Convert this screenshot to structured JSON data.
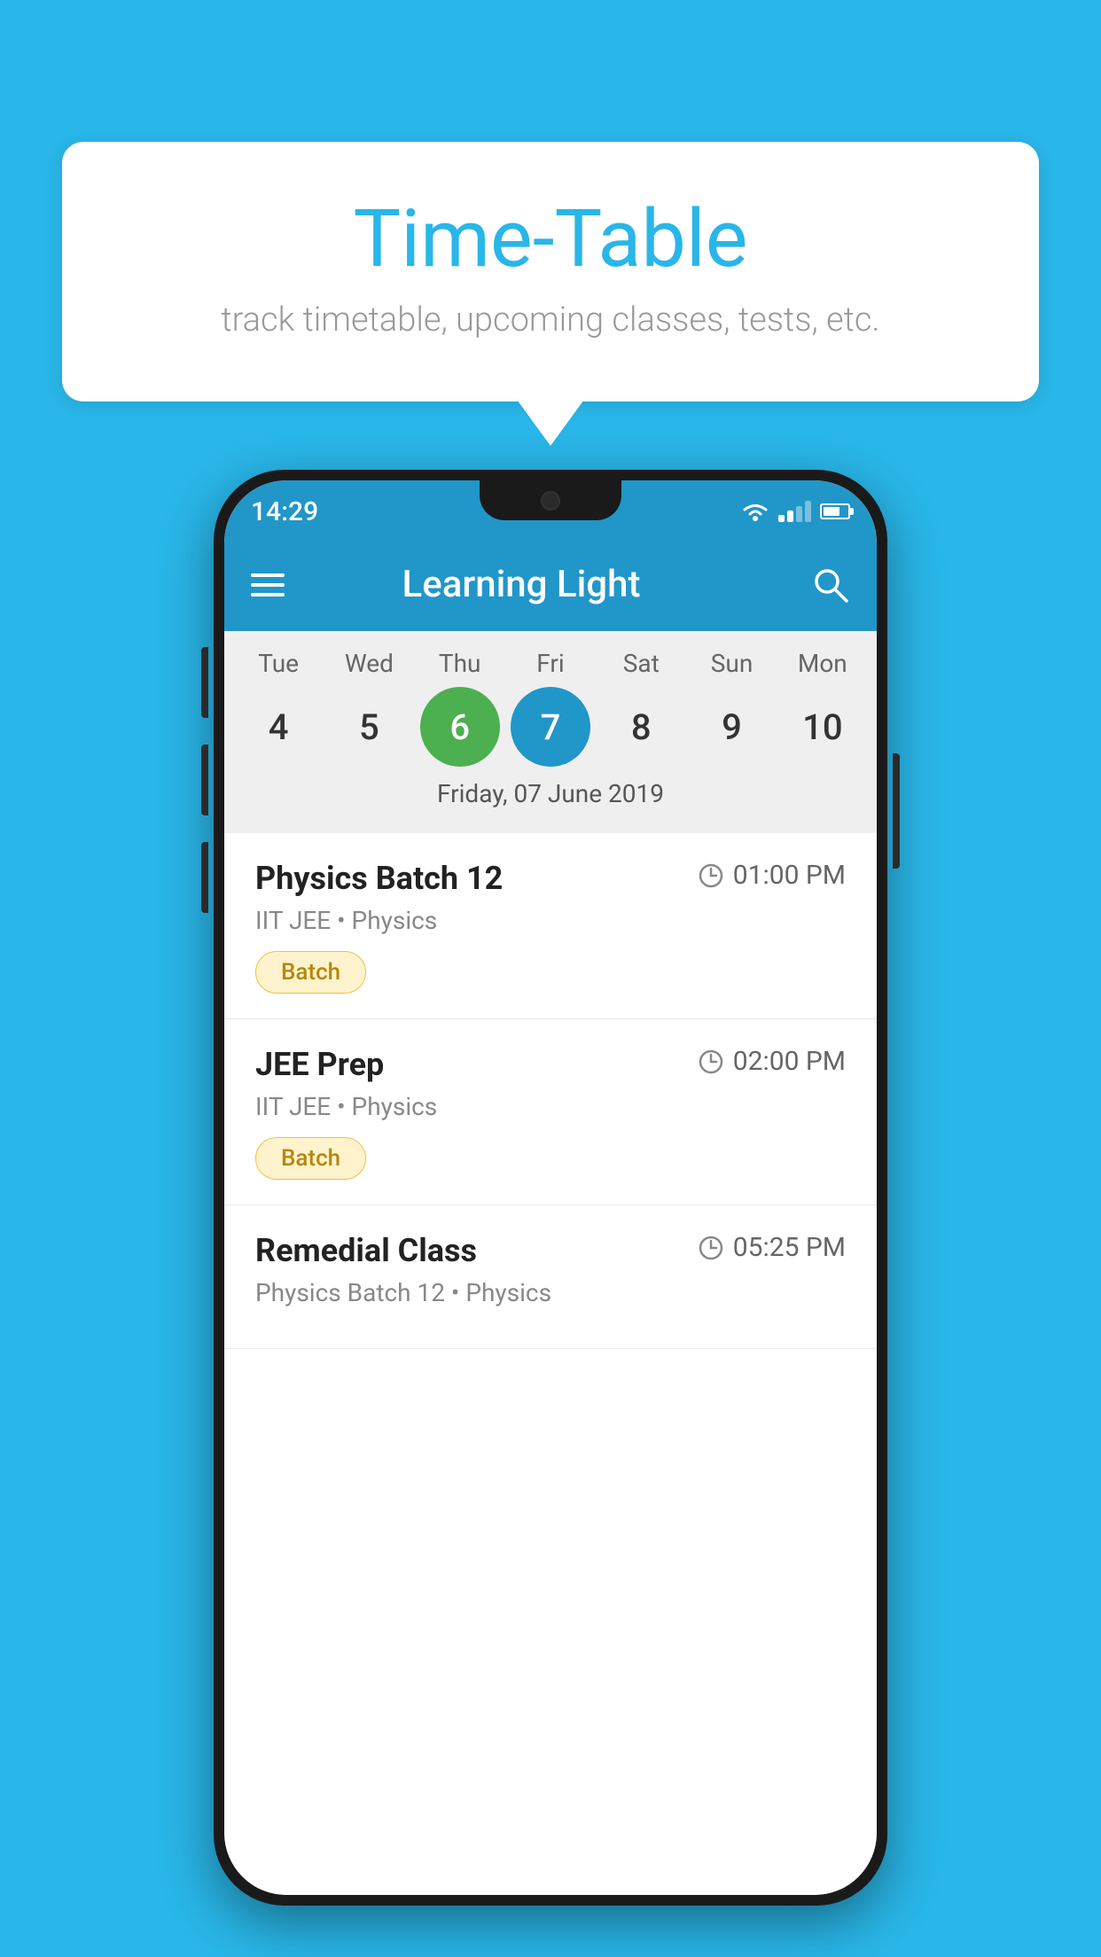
{
  "background_color": "#29B6E8",
  "speech_bubble": {
    "title": "Time-Table",
    "subtitle": "track timetable, upcoming classes, tests, etc."
  },
  "phone": {
    "status_bar": {
      "time": "14:29"
    },
    "app_bar": {
      "title": "Learning Light"
    },
    "calendar": {
      "days": [
        {
          "label": "Tue",
          "number": "4"
        },
        {
          "label": "Wed",
          "number": "5"
        },
        {
          "label": "Thu",
          "number": "6",
          "state": "today"
        },
        {
          "label": "Fri",
          "number": "7",
          "state": "selected"
        },
        {
          "label": "Sat",
          "number": "8"
        },
        {
          "label": "Sun",
          "number": "9"
        },
        {
          "label": "Mon",
          "number": "10"
        }
      ],
      "selected_date": "Friday, 07 June 2019"
    },
    "classes": [
      {
        "name": "Physics Batch 12",
        "time": "01:00 PM",
        "meta": "IIT JEE • Physics",
        "badge": "Batch"
      },
      {
        "name": "JEE Prep",
        "time": "02:00 PM",
        "meta": "IIT JEE • Physics",
        "badge": "Batch"
      },
      {
        "name": "Remedial Class",
        "time": "05:25 PM",
        "meta": "Physics Batch 12 • Physics",
        "badge": ""
      }
    ]
  }
}
